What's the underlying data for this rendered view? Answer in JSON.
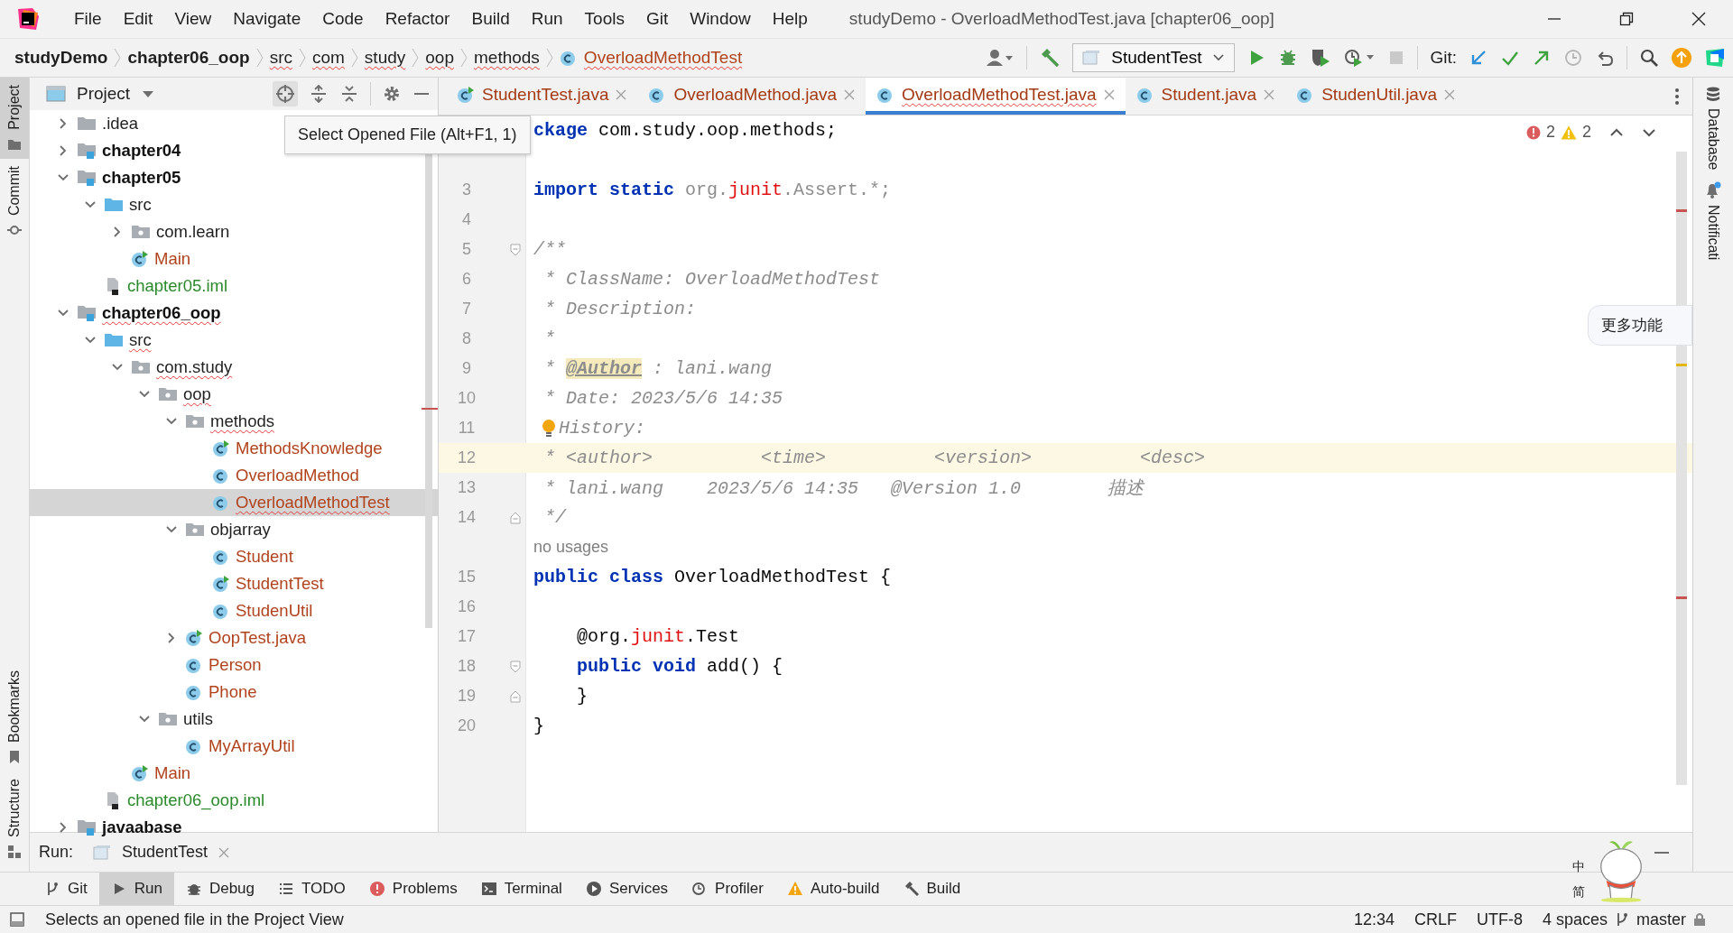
{
  "window": {
    "title": "studyDemo - OverloadMethodTest.java [chapter06_oop]"
  },
  "menu": [
    "File",
    "Edit",
    "View",
    "Navigate",
    "Code",
    "Refactor",
    "Build",
    "Run",
    "Tools",
    "Git",
    "Window",
    "Help"
  ],
  "breadcrumbs": [
    {
      "label": "studyDemo",
      "kind": "module",
      "squiggle": false
    },
    {
      "label": "chapter06_oop",
      "kind": "module",
      "squiggle": false
    },
    {
      "label": "src",
      "kind": "folder",
      "squiggle": true
    },
    {
      "label": "com",
      "kind": "folder",
      "squiggle": true
    },
    {
      "label": "study",
      "kind": "folder",
      "squiggle": true
    },
    {
      "label": "oop",
      "kind": "folder",
      "squiggle": true
    },
    {
      "label": "methods",
      "kind": "folder",
      "squiggle": true
    },
    {
      "label": "OverloadMethodTest",
      "kind": "class",
      "squiggle": true
    }
  ],
  "toolbar": {
    "run_config": "StudentTest",
    "git_label": "Git:"
  },
  "left_stripe": {
    "top": [
      {
        "label": "Project",
        "selected": true
      },
      {
        "label": "Commit",
        "selected": false
      }
    ],
    "bottom": [
      {
        "label": "Bookmarks",
        "selected": false
      },
      {
        "label": "Structure",
        "selected": false
      }
    ]
  },
  "project_panel": {
    "title": "Project",
    "tooltip": "Select Opened File (Alt+F1, 1)",
    "tree": [
      {
        "label": ".idea",
        "kind": "folder",
        "expanded": false,
        "selected": false,
        "squiggle": false
      },
      {
        "label": "chapter04",
        "kind": "module",
        "expanded": false,
        "selected": false,
        "squiggle": false
      },
      {
        "label": "chapter05",
        "kind": "module",
        "expanded": true,
        "selected": false,
        "squiggle": false,
        "children": [
          {
            "label": "src",
            "kind": "source-folder",
            "expanded": true,
            "selected": false,
            "squiggle": false,
            "children": [
              {
                "label": "com.learn",
                "kind": "package",
                "expanded": false,
                "selected": false,
                "squiggle": false
              },
              {
                "label": "Main",
                "kind": "runnable-class",
                "selected": false,
                "squiggle": false
              }
            ]
          },
          {
            "label": "chapter05.iml",
            "kind": "iml",
            "selected": false,
            "squiggle": false
          }
        ]
      },
      {
        "label": "chapter06_oop",
        "kind": "module",
        "expanded": true,
        "selected": false,
        "squiggle": true,
        "children": [
          {
            "label": "src",
            "kind": "source-folder",
            "expanded": true,
            "selected": false,
            "squiggle": true,
            "children": [
              {
                "label": "com.study",
                "kind": "package",
                "expanded": true,
                "selected": false,
                "squiggle": true,
                "children": [
                  {
                    "label": "oop",
                    "kind": "package",
                    "expanded": true,
                    "selected": false,
                    "squiggle": true,
                    "children": [
                      {
                        "label": "methods",
                        "kind": "package",
                        "expanded": true,
                        "selected": false,
                        "squiggle": true,
                        "children": [
                          {
                            "label": "MethodsKnowledge",
                            "kind": "runnable-class",
                            "selected": false,
                            "squiggle": false
                          },
                          {
                            "label": "OverloadMethod",
                            "kind": "class",
                            "selected": false,
                            "squiggle": false
                          },
                          {
                            "label": "OverloadMethodTest",
                            "kind": "class",
                            "selected": true,
                            "squiggle": true
                          }
                        ]
                      },
                      {
                        "label": "objarray",
                        "kind": "package",
                        "expanded": true,
                        "selected": false,
                        "squiggle": false,
                        "children": [
                          {
                            "label": "Student",
                            "kind": "class",
                            "selected": false,
                            "squiggle": false
                          },
                          {
                            "label": "StudentTest",
                            "kind": "runnable-class",
                            "selected": false,
                            "squiggle": false
                          },
                          {
                            "label": "StudenUtil",
                            "kind": "class",
                            "selected": false,
                            "squiggle": false
                          }
                        ]
                      },
                      {
                        "label": "OopTest.java",
                        "kind": "runnable-class",
                        "expanded": false,
                        "selected": false,
                        "squiggle": false
                      },
                      {
                        "label": "Person",
                        "kind": "class",
                        "selected": false,
                        "squiggle": false
                      },
                      {
                        "label": "Phone",
                        "kind": "class",
                        "selected": false,
                        "squiggle": false
                      }
                    ]
                  },
                  {
                    "label": "utils",
                    "kind": "package",
                    "expanded": true,
                    "selected": false,
                    "squiggle": false,
                    "children": [
                      {
                        "label": "MyArrayUtil",
                        "kind": "class",
                        "selected": false,
                        "squiggle": false
                      }
                    ]
                  }
                ]
              },
              {
                "label": "Main",
                "kind": "runnable-class",
                "selected": false,
                "squiggle": false
              }
            ]
          },
          {
            "label": "chapter06_oop.iml",
            "kind": "iml",
            "selected": false,
            "squiggle": false
          }
        ]
      },
      {
        "label": "javaabase",
        "kind": "module",
        "expanded": false,
        "selected": false,
        "squiggle": false
      }
    ]
  },
  "tabs": [
    {
      "label": "StudentTest.java",
      "runnable": true,
      "selected": false,
      "squiggle": false
    },
    {
      "label": "OverloadMethod.java",
      "runnable": false,
      "selected": false,
      "squiggle": false
    },
    {
      "label": "OverloadMethodTest.java",
      "runnable": false,
      "selected": true,
      "squiggle": true
    },
    {
      "label": "Student.java",
      "runnable": false,
      "selected": false,
      "squiggle": false
    },
    {
      "label": "StudenUtil.java",
      "runnable": false,
      "selected": false,
      "squiggle": false
    }
  ],
  "editor": {
    "errors": "2",
    "warnings": "2",
    "float_button": "更多功能",
    "lines": [
      {
        "kind": "code",
        "current": false,
        "segments": [
          {
            "kind": "keyword",
            "text": "ckage"
          },
          {
            "kind": "plain",
            "text": " com.study.oop.methods;"
          }
        ]
      },
      {
        "kind": "code",
        "current": false
      },
      {
        "kind": "code",
        "number": "3",
        "current": false,
        "segments": [
          {
            "kind": "keyword",
            "text": "import static"
          },
          {
            "kind": "unused",
            "text": " org."
          },
          {
            "kind": "error",
            "text": "junit"
          },
          {
            "kind": "unused",
            "text": ".Assert.*;"
          }
        ]
      },
      {
        "kind": "code",
        "number": "4",
        "current": false
      },
      {
        "kind": "code",
        "number": "5",
        "current": false,
        "fold_start": true,
        "segments": [
          {
            "kind": "comment",
            "text": "/**"
          }
        ]
      },
      {
        "kind": "code",
        "number": "6",
        "current": false,
        "segments": [
          {
            "kind": "comment",
            "text": " * ClassName: OverloadMethodTest"
          }
        ]
      },
      {
        "kind": "code",
        "number": "7",
        "current": false,
        "segments": [
          {
            "kind": "comment",
            "text": " * Description:"
          }
        ]
      },
      {
        "kind": "code",
        "number": "8",
        "current": false,
        "segments": [
          {
            "kind": "comment",
            "text": " *"
          }
        ]
      },
      {
        "kind": "code",
        "number": "9",
        "current": false,
        "segments": [
          {
            "kind": "comment",
            "text": " * "
          },
          {
            "kind": "doctag",
            "text": "@Author"
          },
          {
            "kind": "comment",
            "text": " : lani.wang"
          }
        ]
      },
      {
        "kind": "code",
        "number": "10",
        "current": false,
        "segments": [
          {
            "kind": "comment",
            "text": " * Date: 2023/5/6 14:35"
          }
        ]
      },
      {
        "kind": "code",
        "number": "11",
        "current": false,
        "segments": [
          {
            "kind": "bulb"
          },
          {
            "kind": "comment",
            "text": "History:"
          }
        ]
      },
      {
        "kind": "code",
        "number": "12",
        "current": true,
        "segments": [
          {
            "kind": "comment",
            "text": " * <author>          <time>          <version>          <desc>"
          }
        ]
      },
      {
        "kind": "code",
        "number": "13",
        "current": false,
        "segments": [
          {
            "kind": "comment",
            "text": " * lani.wang    2023/5/6 14:35   @Version 1.0        描述"
          }
        ]
      },
      {
        "kind": "code",
        "number": "14",
        "current": false,
        "fold_end": true,
        "segments": [
          {
            "kind": "comment",
            "text": " */"
          }
        ]
      },
      {
        "kind": "hint",
        "text": "no usages"
      },
      {
        "kind": "code",
        "number": "15",
        "current": false,
        "segments": [
          {
            "kind": "keyword",
            "text": "public class"
          },
          {
            "kind": "plain",
            "text": " OverloadMethodTest {"
          }
        ]
      },
      {
        "kind": "code",
        "number": "16",
        "current": false
      },
      {
        "kind": "code",
        "number": "17",
        "current": false,
        "segments": [
          {
            "kind": "plain",
            "text": "    @org."
          },
          {
            "kind": "error",
            "text": "junit"
          },
          {
            "kind": "plain",
            "text": ".Test"
          }
        ]
      },
      {
        "kind": "code",
        "number": "18",
        "current": false,
        "fold_start": true,
        "segments": [
          {
            "kind": "keyword",
            "text": "    public void"
          },
          {
            "kind": "plain",
            "text": " add() {"
          }
        ]
      },
      {
        "kind": "code",
        "number": "19",
        "current": false,
        "fold_end": true,
        "segments": [
          {
            "kind": "plain",
            "text": "    }"
          }
        ]
      },
      {
        "kind": "code",
        "number": "20",
        "current": false,
        "segments": [
          {
            "kind": "plain",
            "text": "}"
          }
        ]
      }
    ]
  },
  "right_stripe": [
    "Database",
    "Notificati"
  ],
  "run_bar": {
    "label": "Run:",
    "tab": "StudentTest"
  },
  "tool_tabs": [
    {
      "label": "Git",
      "kind": "git",
      "selected": false
    },
    {
      "label": "Run",
      "kind": "run",
      "selected": true
    },
    {
      "label": "Debug",
      "kind": "debug",
      "selected": false
    },
    {
      "label": "TODO",
      "kind": "todo",
      "selected": false
    },
    {
      "label": "Problems",
      "kind": "problems",
      "selected": false
    },
    {
      "label": "Terminal",
      "kind": "terminal",
      "selected": false
    },
    {
      "label": "Services",
      "kind": "services",
      "selected": false
    },
    {
      "label": "Profiler",
      "kind": "profiler",
      "selected": false
    },
    {
      "label": "Auto-build",
      "kind": "warning",
      "selected": false
    },
    {
      "label": "Build",
      "kind": "build",
      "selected": false
    }
  ],
  "ime": [
    "中",
    "简"
  ],
  "status_bar": {
    "message": "Selects an opened file in the Project View",
    "items": [
      "12:34",
      "CRLF",
      "UTF-8",
      "4 spaces"
    ],
    "branch": "master"
  }
}
